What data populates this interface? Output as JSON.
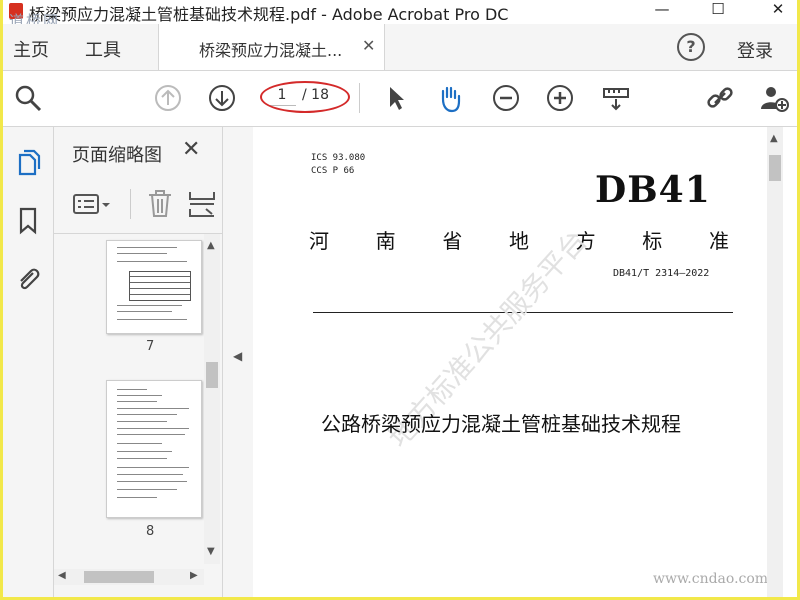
{
  "window": {
    "title": "桥梁预应力混凝土管桩基础技术规程.pdf - Adobe Acrobat Pro DC",
    "watermark": "道桥网",
    "controls": {
      "minimize": "—",
      "maximize": "☐",
      "close": "✕"
    }
  },
  "tabs": {
    "home": "主页",
    "tools": "工具",
    "document": "桥梁预应力混凝土...",
    "close": "✕",
    "help": "?",
    "login": "登录"
  },
  "toolbar": {
    "page_current": "1",
    "page_total": "/ 18",
    "icons": [
      "search-icon",
      "page-up-icon",
      "page-down-icon",
      "select-arrow-icon",
      "hand-icon",
      "zoom-out-icon",
      "zoom-in-icon",
      "measure-icon",
      "share-link-icon",
      "add-user-icon"
    ],
    "accent": "#1d6fc4",
    "annotation_color": "#d42a2a"
  },
  "thumbnails": {
    "title": "页面缩略图",
    "close": "✕",
    "pages": [
      {
        "number": "7"
      },
      {
        "number": "8"
      }
    ]
  },
  "document": {
    "ics": "ICS  93.080",
    "ccs": "CCS P  66",
    "logo": "DB41",
    "province": [
      "河",
      "南",
      "省",
      "地",
      "方",
      "标",
      "准"
    ],
    "std_number": "DB41/T 2314—2022",
    "doc_title": "公路桥梁预应力混凝土管桩基础技术规程",
    "watermark": "地方标准公共服务平台",
    "site": "www.cndao.com"
  }
}
